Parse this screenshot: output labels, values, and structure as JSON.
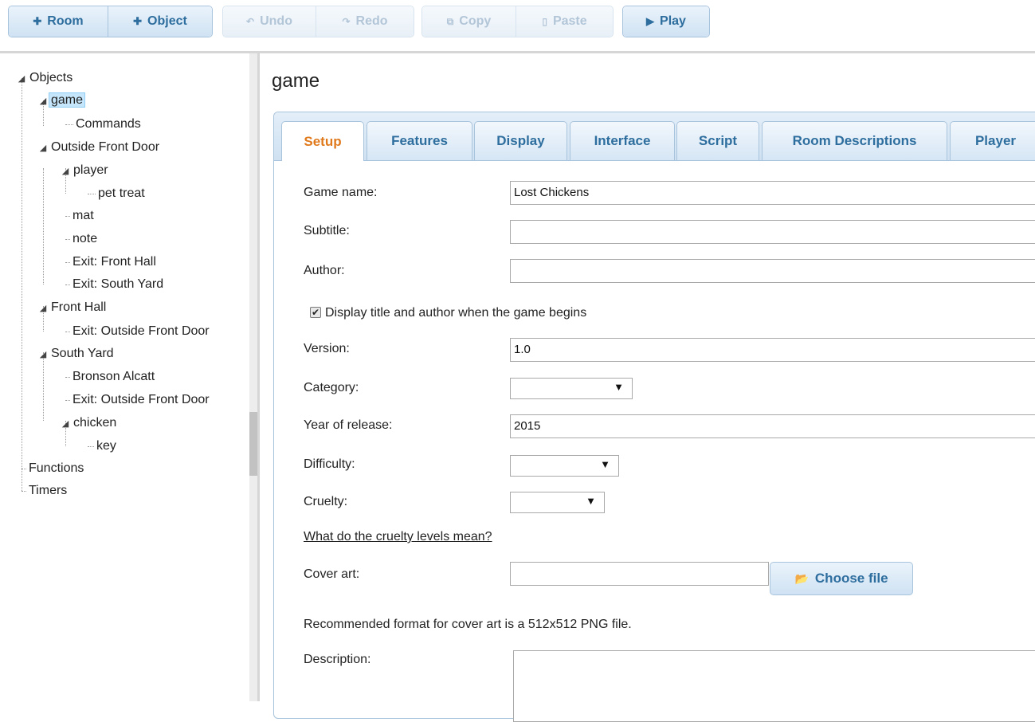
{
  "toolbar": {
    "add_room": "Room",
    "add_object": "Object",
    "undo": "Undo",
    "redo": "Redo",
    "copy": "Copy",
    "paste": "Paste",
    "play": "Play"
  },
  "tree": {
    "objects": "Objects",
    "game": "game",
    "commands": "Commands",
    "outside_front_door": "Outside Front Door",
    "player": "player",
    "pet_treat": "pet treat",
    "mat": "mat",
    "note": "note",
    "exit_front_hall": "Exit: Front Hall",
    "exit_south_yard": "Exit: South Yard",
    "front_hall": "Front Hall",
    "exit_outside_front_door_1": "Exit: Outside Front Door",
    "south_yard": "South Yard",
    "bronson_alcatt": "Bronson Alcatt",
    "exit_outside_front_door_2": "Exit: Outside Front Door",
    "chicken": "chicken",
    "key": "key",
    "functions": "Functions",
    "timers": "Timers"
  },
  "editor": {
    "title": "game",
    "tabs": [
      "Setup",
      "Features",
      "Display",
      "Interface",
      "Script",
      "Room Descriptions",
      "Player"
    ],
    "active_tab": "Setup",
    "labels": {
      "game_name": "Game name:",
      "subtitle": "Subtitle:",
      "author": "Author:",
      "display_title": "Display title and author when the game begins",
      "version": "Version:",
      "category": "Category:",
      "year": "Year of release:",
      "difficulty": "Difficulty:",
      "cruelty": "Cruelty:",
      "cruelty_link": "What do the cruelty levels mean?",
      "cover_art": "Cover art:",
      "choose_file": "Choose file",
      "cover_note": "Recommended format for cover art is a 512x512 PNG file.",
      "description": "Description:"
    },
    "values": {
      "game_name": "Lost Chickens",
      "subtitle": "",
      "author": "",
      "version": "1.0",
      "year": "2015",
      "category": "",
      "difficulty": "",
      "cruelty": "",
      "cover_art": ""
    },
    "display_title_checked": true
  },
  "colors": {
    "accent": "#2e6e9e",
    "active_tab_text": "#e0791c",
    "selection": "#c5e6fb"
  }
}
